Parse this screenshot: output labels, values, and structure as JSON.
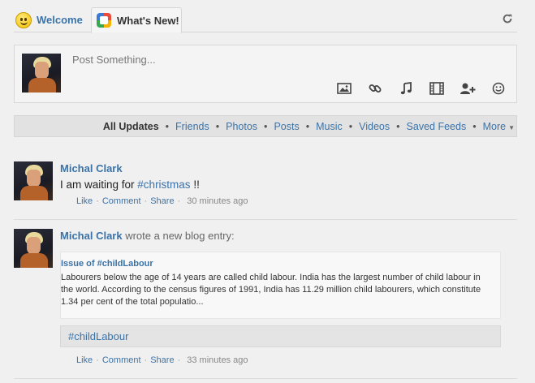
{
  "tabs": {
    "welcome": "Welcome",
    "whats_new": "What's New!"
  },
  "composer": {
    "placeholder": "Post Something...",
    "tools": [
      "image-icon",
      "link-icon",
      "music-icon",
      "film-icon",
      "add-user-icon",
      "smiley-icon"
    ]
  },
  "filters": {
    "all_updates": "All Updates",
    "friends": "Friends",
    "photos": "Photos",
    "posts": "Posts",
    "music": "Music",
    "videos": "Videos",
    "saved_feeds": "Saved Feeds",
    "more": "More"
  },
  "feed": [
    {
      "author": "Michal Clark",
      "status_prefix": "I am waiting for ",
      "status_tag": "#christmas",
      "status_suffix": " !!",
      "like": "Like",
      "comment": "Comment",
      "share": "Share",
      "time": "30 minutes ago"
    },
    {
      "author": "Michal Clark",
      "action": "wrote a new blog entry:",
      "blog_title": "Issue of #childLabour",
      "blog_body": "Labourers below the age of 14 years are called child labour. India has the largest number of child labour in the world. According to the census figures of 1991, India has 11.29 million child labourers, which constitute 1.34 per cent of the total populatio...",
      "tag": "#childLabour",
      "like": "Like",
      "comment": "Comment",
      "share": "Share",
      "time": "33 minutes ago"
    }
  ],
  "colors": {
    "link": "#3b73a8",
    "background": "#f0f0f0"
  }
}
